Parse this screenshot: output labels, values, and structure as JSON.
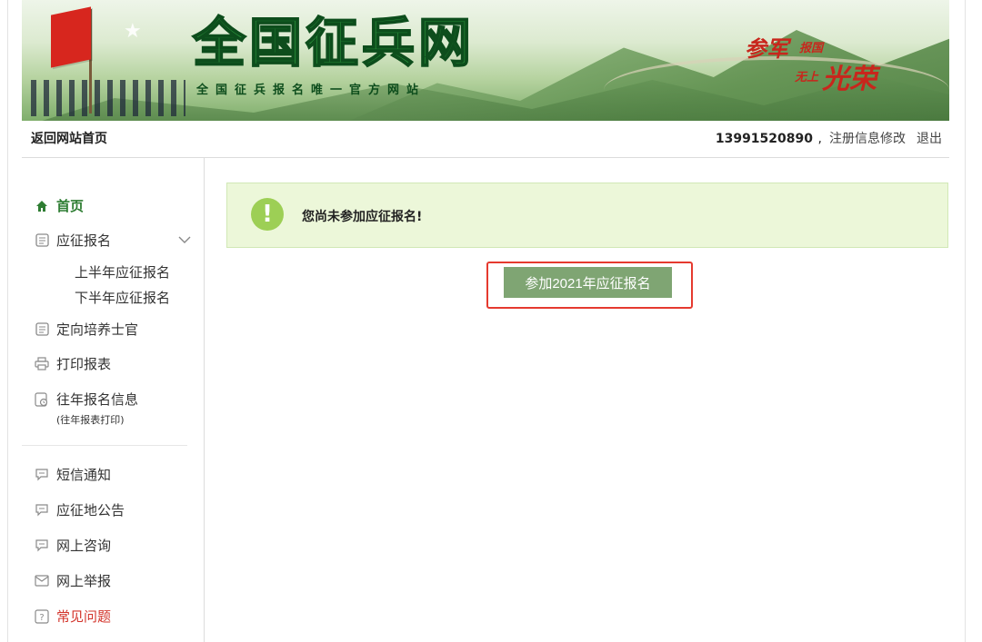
{
  "banner": {
    "title": "全国征兵网",
    "subtitle": "全国征兵报名唯一官方网站",
    "slogan": {
      "line1": "参军",
      "line2": "报国",
      "line3": "无上",
      "line4": "光荣"
    }
  },
  "topbar": {
    "home_link": "返回网站首页",
    "user_phone": "13991520890",
    "comma": ",",
    "edit_link": "注册信息修改",
    "logout_link": "退出"
  },
  "sidebar": {
    "items": [
      {
        "label": "首页",
        "icon": "home-icon"
      },
      {
        "label": "应征报名",
        "icon": "form-icon"
      },
      {
        "label": "上半年应征报名"
      },
      {
        "label": "下半年应征报名"
      },
      {
        "label": "定向培养士官",
        "icon": "form-icon"
      },
      {
        "label": "打印报表",
        "icon": "printer-icon"
      },
      {
        "label": "往年报名信息",
        "note": "(往年报表打印)",
        "icon": "history-doc-icon"
      },
      {
        "label": "短信通知",
        "icon": "chat-icon"
      },
      {
        "label": "应征地公告",
        "icon": "chat-icon"
      },
      {
        "label": "网上咨询",
        "icon": "chat-icon"
      },
      {
        "label": "网上举报",
        "icon": "mail-icon"
      },
      {
        "label": "常见问题",
        "icon": "question-icon"
      }
    ]
  },
  "main": {
    "alert_icon": "!",
    "alert_message": "您尚未参加应征报名!",
    "join_button": "参加2021年应征报名"
  },
  "colors": {
    "accent_green": "#2e7d32",
    "button_green": "#7fa573",
    "alert_bg": "#ecf7d9",
    "highlight_red": "#e53a2f"
  }
}
